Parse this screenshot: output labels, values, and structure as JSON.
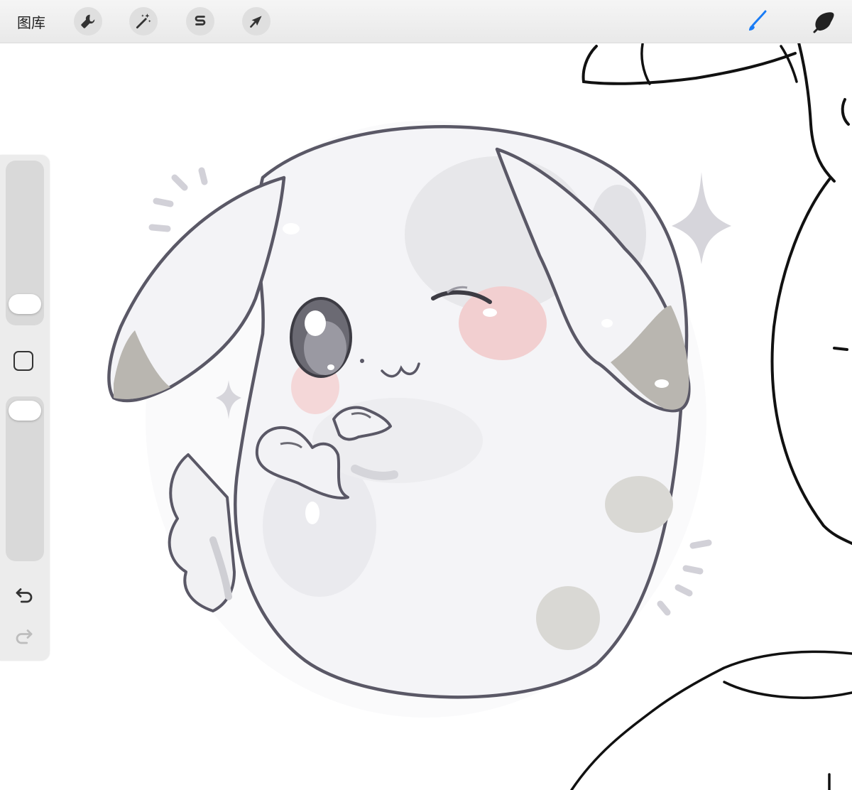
{
  "toolbar": {
    "gallery_label": "图库",
    "left_tools": [
      {
        "name": "actions",
        "icon": "wrench-icon"
      },
      {
        "name": "adjustments",
        "icon": "magic-wand-icon"
      },
      {
        "name": "selection",
        "icon": "selection-s-icon"
      },
      {
        "name": "transform",
        "icon": "arrow-cursor-icon"
      }
    ],
    "right_tools": [
      {
        "name": "brush",
        "icon": "brush-icon",
        "active": true
      },
      {
        "name": "smudge",
        "icon": "smudge-icon",
        "active": false
      }
    ]
  },
  "sidebar": {
    "brush_size_level": 0.3,
    "opacity_level": 0.9,
    "modify_button": "square-modify-icon",
    "undo_icon": "undo-icon",
    "redo_icon": "redo-icon"
  },
  "colors": {
    "accent": "#1a7cf5",
    "toolbar_bg": "#eeeeee",
    "sidebar_bg": "#ececec",
    "line_art": "#5a5866",
    "sketch_lines": "#111111",
    "body_fill": "#f4f4f7",
    "ear_inner": "#b9b6b0",
    "blush": "#f2cfd0"
  }
}
